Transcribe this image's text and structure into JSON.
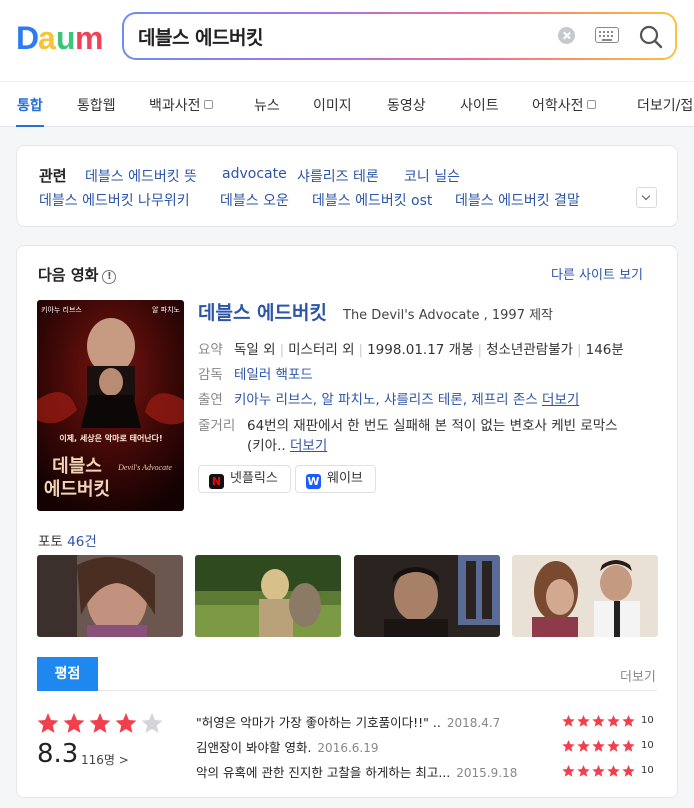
{
  "search": {
    "query": "데블스 에드버킷"
  },
  "tabs": [
    {
      "label": "통합"
    },
    {
      "label": "통합웹"
    },
    {
      "label": "백과사전"
    },
    {
      "label": "뉴스"
    },
    {
      "label": "이미지"
    },
    {
      "label": "동영상"
    },
    {
      "label": "사이트"
    },
    {
      "label": "어학사전"
    },
    {
      "label": "더보기/접"
    }
  ],
  "related": {
    "title": "관련",
    "items": [
      "데블스 에드버킷 뜻",
      "advocate",
      "샤를리즈 테론",
      "코니 닐슨",
      "데블스 에드버킷 나무위키",
      "데블스 오운",
      "데블스 에드버킷 ost",
      "데블스 에드버킷 결말"
    ]
  },
  "movie": {
    "section_title": "다음 영화",
    "info_icon": "!",
    "other_sites": "다른 사이트 보기",
    "poster": {
      "tagline": "이제, 세상은 악마로 태어난다!",
      "title": "데블스 에드버킷",
      "top_left": "키아누 리브스",
      "top_right": "알 파치노",
      "en_title": "Devil's Advocate"
    },
    "title": "데블스 에드버킷",
    "subtitle": "The Devil's Advocate , 1997 제작",
    "summary_label": "요약",
    "summary": [
      "독일 외",
      "미스터리 외",
      "1998.01.17 개봉",
      "청소년관람불가",
      "146분"
    ],
    "director_label": "감독",
    "director": "테일러 핵포드",
    "cast_label": "출연",
    "cast": "키아누 리브스, 알 파치노, 샤를리즈 테론, 제프리 존스",
    "cast_more": "더보기",
    "plot_label": "줄거리",
    "plot_line1": "64번의 재판에서 한 번도 실패해 본 적이 없는 변호사 케빈 로막스",
    "plot_line2": "(키아..",
    "plot_more": "더보기",
    "ott": [
      {
        "label": "넷플릭스",
        "icon": "N",
        "color": "#111111",
        "icon_color": "#e50914"
      },
      {
        "label": "웨이브",
        "icon": "W",
        "color": "#1a5cff",
        "icon_color": "#ffffff"
      }
    ],
    "photos_label": "포토",
    "photos_count": "46건"
  },
  "rating": {
    "tab": "평점",
    "more": "더보기",
    "score": "8.3",
    "stars_filled": 4,
    "count": "116명 >",
    "reviews": [
      {
        "text": "\"허영은 악마가 가장 좋아하는 기호품이다!!\" ..",
        "date": "2018.4.7",
        "score": "10",
        "stars": 5
      },
      {
        "text": "김앤장이 봐야할 영화.",
        "date": "2016.6.19",
        "score": "10",
        "stars": 5
      },
      {
        "text": "악의 유혹에 관한 진지한 고찰을 하게하는 최고...",
        "date": "2015.9.18",
        "score": "10",
        "stars": 5
      }
    ]
  },
  "colors": {
    "accent": "#2472d4",
    "link": "#2c55a8",
    "star": "#f1404b",
    "rate_tab": "#1e88f0"
  }
}
